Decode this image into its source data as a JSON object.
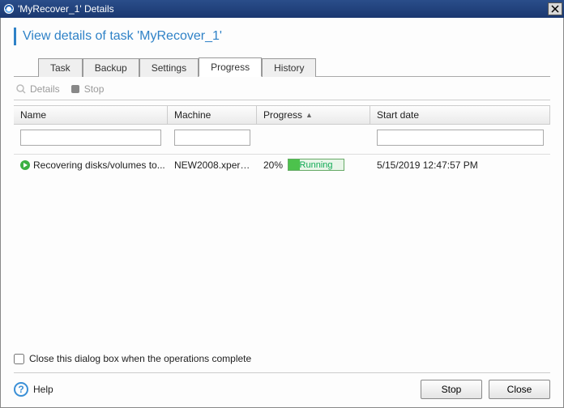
{
  "window": {
    "title": "'MyRecover_1' Details"
  },
  "page_title": "View details of task 'MyRecover_1'",
  "tabs": {
    "task": "Task",
    "backup": "Backup",
    "settings": "Settings",
    "progress": "Progress",
    "history": "History",
    "active": "Progress"
  },
  "toolbar": {
    "details": "Details",
    "stop": "Stop"
  },
  "columns": {
    "name": "Name",
    "machine": "Machine",
    "progress": "Progress",
    "start": "Start date"
  },
  "row": {
    "name": "Recovering disks/volumes to...",
    "machine": "NEW2008.xperts...",
    "percent": "20%",
    "status": "Running",
    "start": "5/15/2019 12:47:57 PM"
  },
  "checkbox_label": "Close this dialog box when the operations complete",
  "footer": {
    "help": "Help",
    "stop": "Stop",
    "close": "Close"
  }
}
